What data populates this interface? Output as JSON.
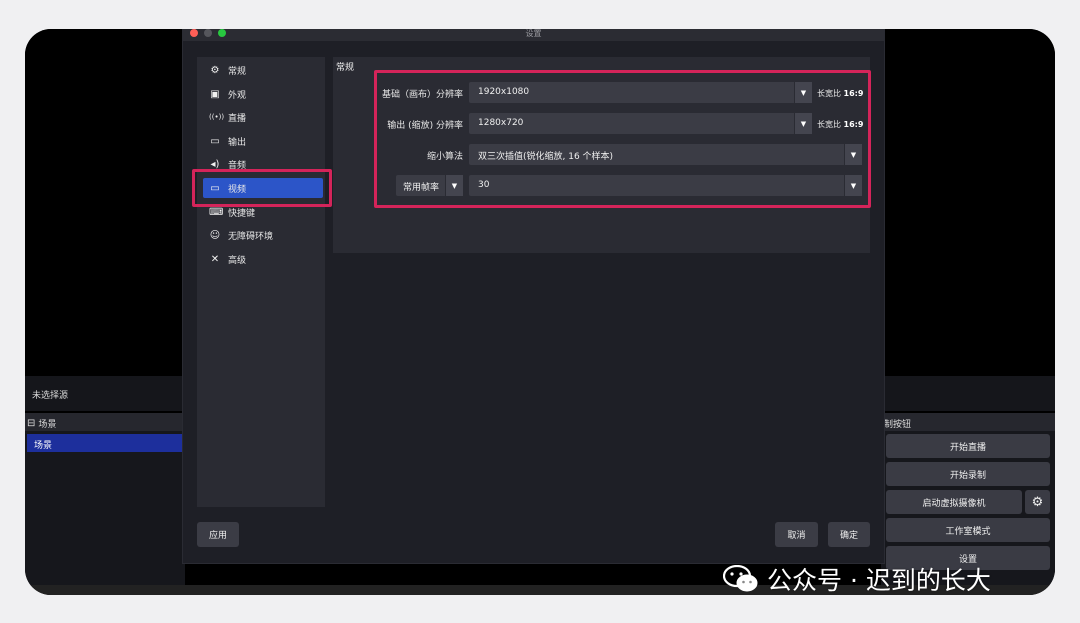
{
  "dialog": {
    "title": "设置"
  },
  "sidebar": {
    "items": [
      {
        "label": "常规",
        "icon": "gear-icon",
        "glyph": "⚙"
      },
      {
        "label": "外观",
        "icon": "appearance-icon",
        "glyph": "▣"
      },
      {
        "label": "直播",
        "icon": "broadcast-icon",
        "glyph": "((•))"
      },
      {
        "label": "输出",
        "icon": "output-icon",
        "glyph": "▭"
      },
      {
        "label": "音频",
        "icon": "speaker-icon",
        "glyph": "🔊"
      },
      {
        "label": "视频",
        "icon": "monitor-icon",
        "glyph": "▭"
      },
      {
        "label": "快捷键",
        "icon": "keyboard-icon",
        "glyph": "⌨"
      },
      {
        "label": "无障碍环境",
        "icon": "accessibility-icon",
        "glyph": "♿"
      },
      {
        "label": "高级",
        "icon": "tools-icon",
        "glyph": "✕"
      }
    ],
    "active_index": 5
  },
  "video": {
    "section_title": "常规",
    "base_label": "基础（画布）分辨率",
    "base_value": "1920x1080",
    "base_aspect_prefix": "长宽比",
    "base_aspect": "16:9",
    "output_label": "输出 (缩放) 分辨率",
    "output_value": "1280x720",
    "output_aspect_prefix": "长宽比",
    "output_aspect": "16:9",
    "filter_label": "缩小算法",
    "filter_value": "双三次插值(锐化缩放, 16 个样本)",
    "fps_type": "常用帧率",
    "fps_value": "30"
  },
  "buttons": {
    "apply": "应用",
    "cancel": "取消",
    "ok": "确定"
  },
  "background": {
    "no_source": "未选择源",
    "scenes_header": "场景",
    "scene_item": "场景",
    "controls_header": "制按钮",
    "start_stream": "开始直播",
    "start_record": "开始录制",
    "virtual_cam": "启动虚拟摄像机",
    "studio_mode": "工作室模式",
    "settings": "设置"
  },
  "watermark": {
    "text": "公众号 · 迟到的长大"
  },
  "colors": {
    "accent": "#2c55c8",
    "highlight": "#d4245a",
    "scene_selected": "#1d2f9c"
  }
}
